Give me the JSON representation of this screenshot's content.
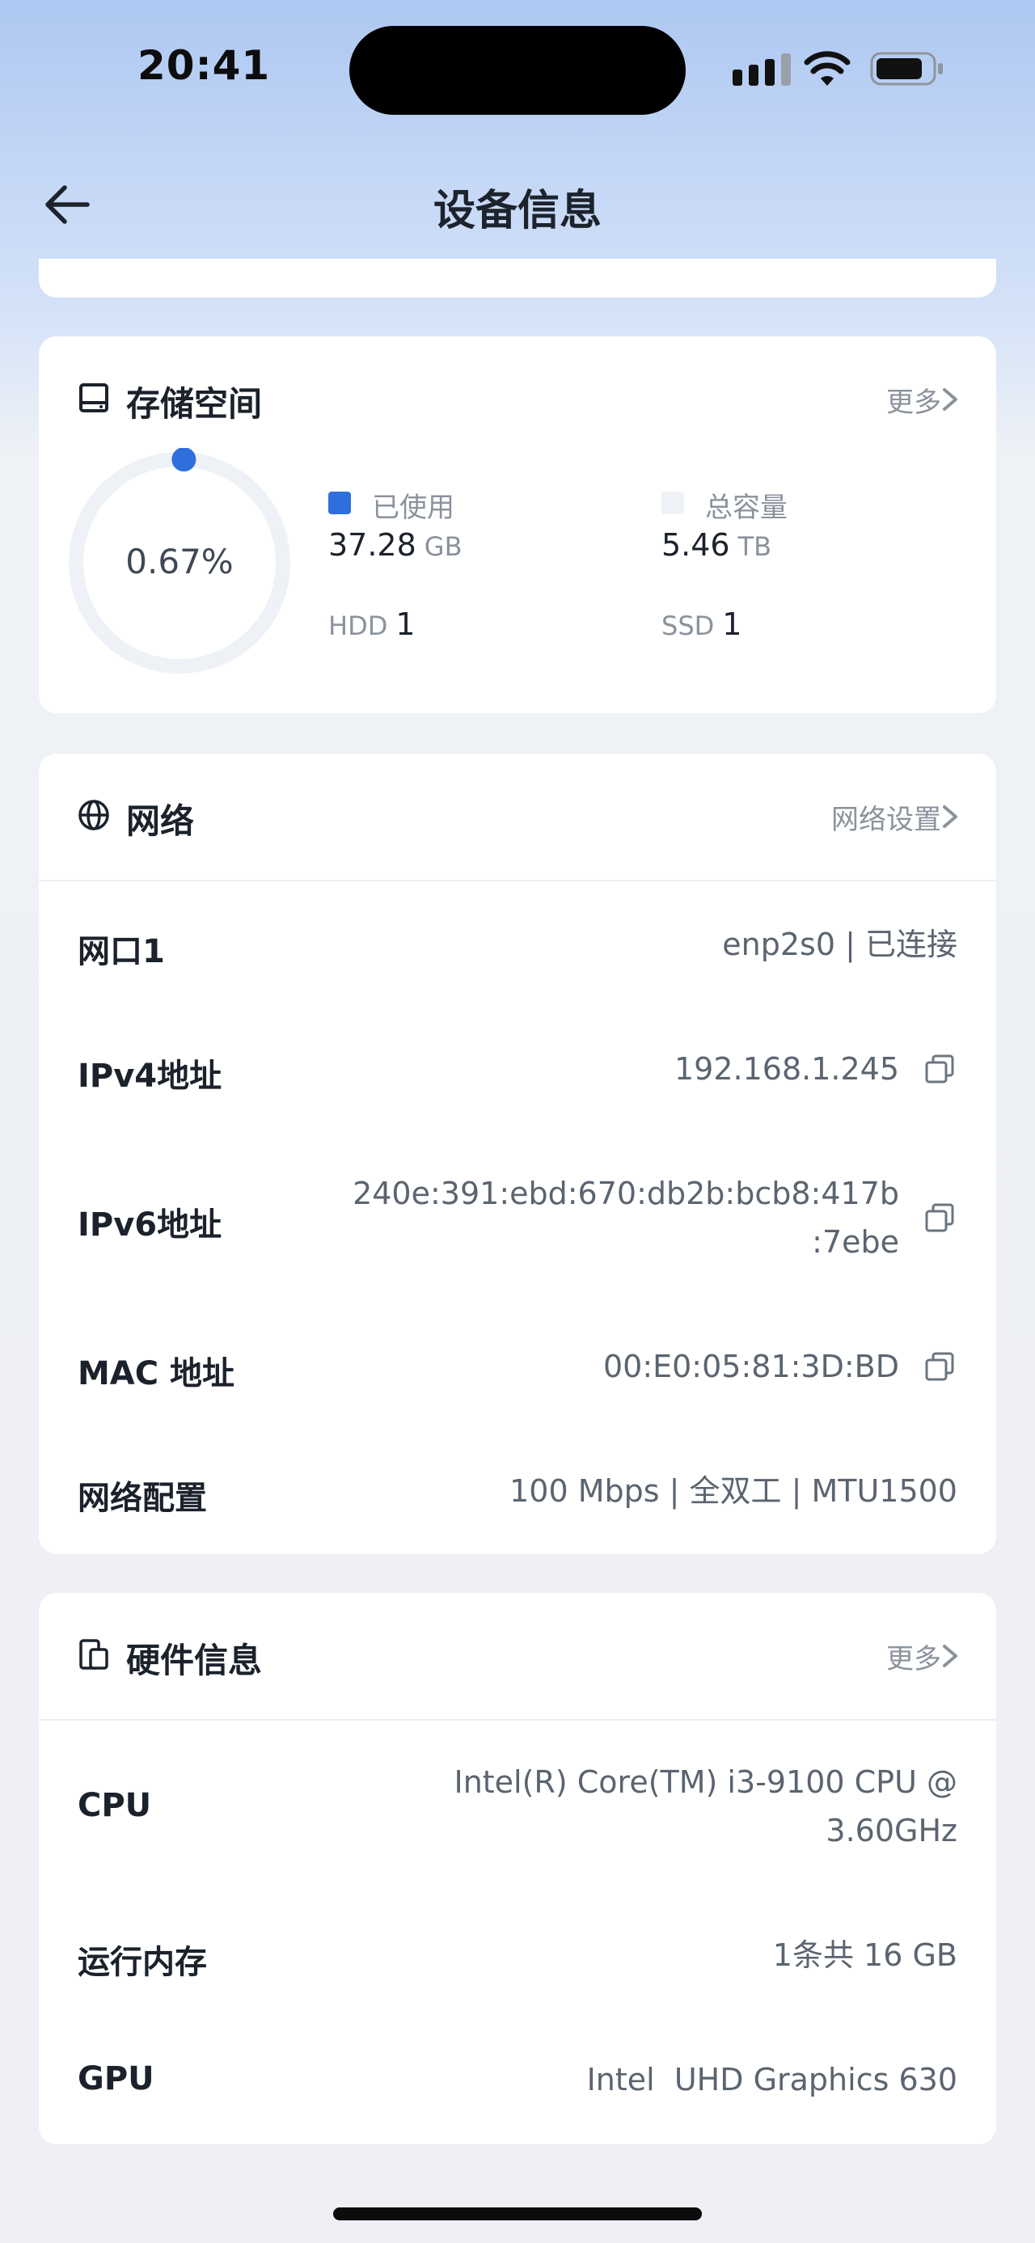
{
  "status_bar": {
    "time": "20:41"
  },
  "nav": {
    "title": "设备信息"
  },
  "storage": {
    "title": "存储空间",
    "more_label": "更多",
    "used_percent": 0.67,
    "percent_label": "0.67%",
    "used": {
      "label": "已使用",
      "value": "37.28",
      "unit": "GB",
      "color": "#2f6fdc"
    },
    "total": {
      "label": "总容量",
      "value": "5.46",
      "unit": "TB",
      "color": "#eef1f5"
    },
    "hdd": {
      "label": "HDD",
      "count": "1"
    },
    "ssd": {
      "label": "SSD",
      "count": "1"
    }
  },
  "network": {
    "title": "网络",
    "settings_label": "网络设置",
    "rows": [
      {
        "label": "网口1",
        "value": "enp2s0 | 已连接"
      },
      {
        "label": "IPv4地址",
        "value": "192.168.1.245"
      },
      {
        "label": "IPv6地址",
        "value_line1": "240e:391:ebd:670:db2b:bcb8:417b",
        "value_line2": ":7ebe"
      },
      {
        "label": "MAC 地址",
        "value": "00:E0:05:81:3D:BD"
      },
      {
        "label": "网络配置",
        "value": "100 Mbps | 全双工 | MTU1500"
      }
    ]
  },
  "hardware": {
    "title": "硬件信息",
    "more_label": "更多",
    "rows": [
      {
        "label": "CPU",
        "value_line1": "Intel(R) Core(TM) i3-9100 CPU @",
        "value_line2": "3.60GHz"
      },
      {
        "label": "运行内存",
        "value": "1条共 16 GB"
      },
      {
        "label": "GPU",
        "value": "Intel  UHD Graphics 630"
      }
    ]
  },
  "colors": {
    "accent": "#2f6fdc",
    "ring_track": "#eef1f5"
  },
  "icons": [
    "signal-icon",
    "wifi-icon",
    "battery-icon",
    "back-arrow-icon",
    "disk-icon",
    "globe-icon",
    "hardware-icon",
    "chevron-right-icon",
    "copy-icon"
  ]
}
